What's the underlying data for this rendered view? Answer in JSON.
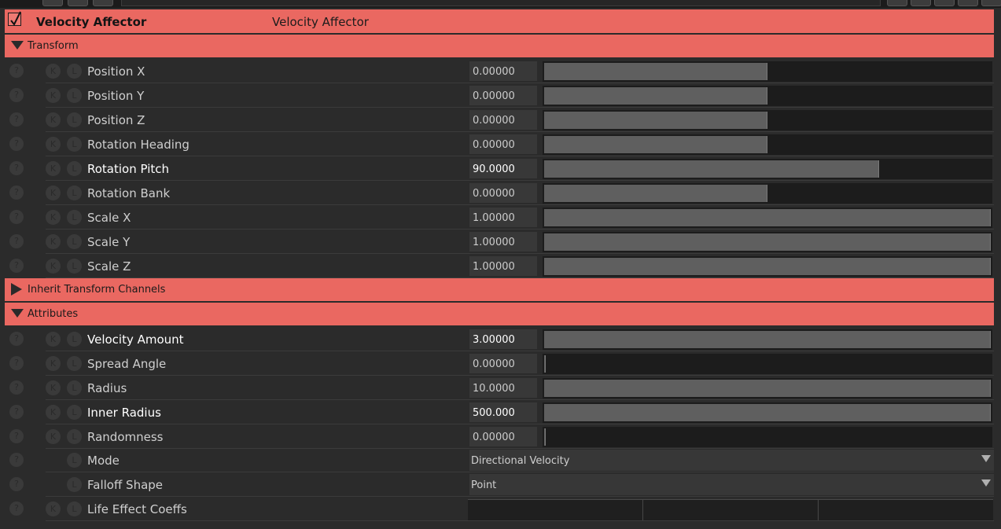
{
  "header": {
    "title": "Velocity Affector",
    "subtitle": "Velocity Affector",
    "enabled": true
  },
  "icons": {
    "help": "?",
    "key": "K",
    "link": "L"
  },
  "sections": {
    "transform": {
      "label": "Transform",
      "expanded": true
    },
    "inherit": {
      "label": "Inherit Transform Channels",
      "expanded": false
    },
    "attributes": {
      "label": "Attributes",
      "expanded": true
    }
  },
  "transform_params": [
    {
      "label": "Position X",
      "value": "0.00000",
      "slider_fraction": 0.5,
      "modified": false
    },
    {
      "label": "Position Y",
      "value": "0.00000",
      "slider_fraction": 0.5,
      "modified": false
    },
    {
      "label": "Position Z",
      "value": "0.00000",
      "slider_fraction": 0.5,
      "modified": false
    },
    {
      "label": "Rotation Heading",
      "value": "0.00000",
      "slider_fraction": 0.5,
      "modified": false
    },
    {
      "label": "Rotation Pitch",
      "value": "90.0000",
      "slider_fraction": 0.75,
      "modified": true
    },
    {
      "label": "Rotation Bank",
      "value": "0.00000",
      "slider_fraction": 0.5,
      "modified": false
    },
    {
      "label": "Scale X",
      "value": "1.00000",
      "slider_fraction": 1.0,
      "modified": false
    },
    {
      "label": "Scale Y",
      "value": "1.00000",
      "slider_fraction": 1.0,
      "modified": false
    },
    {
      "label": "Scale Z",
      "value": "1.00000",
      "slider_fraction": 1.0,
      "modified": false
    }
  ],
  "attribute_params": [
    {
      "label": "Velocity Amount",
      "value": "3.00000",
      "slider_fraction": 1.0,
      "modified": true
    },
    {
      "label": "Spread Angle",
      "value": "0.00000",
      "slider_fraction": 0.0,
      "modified": false
    },
    {
      "label": "Radius",
      "value": "10.0000",
      "slider_fraction": 1.0,
      "modified": false
    },
    {
      "label": "Inner Radius",
      "value": "500.000",
      "slider_fraction": 1.0,
      "modified": true
    },
    {
      "label": "Randomness",
      "value": "0.00000",
      "slider_fraction": 0.0,
      "modified": false
    }
  ],
  "mode": {
    "label": "Mode",
    "value": "Directional Velocity"
  },
  "falloff": {
    "label": "Falloff Shape",
    "value": "Point"
  },
  "life_effect": {
    "label": "Life Effect Coeffs"
  },
  "colors": {
    "accent": "#ea6861",
    "background": "#2b2b2b",
    "slider_fill": "#5f5f5f"
  }
}
